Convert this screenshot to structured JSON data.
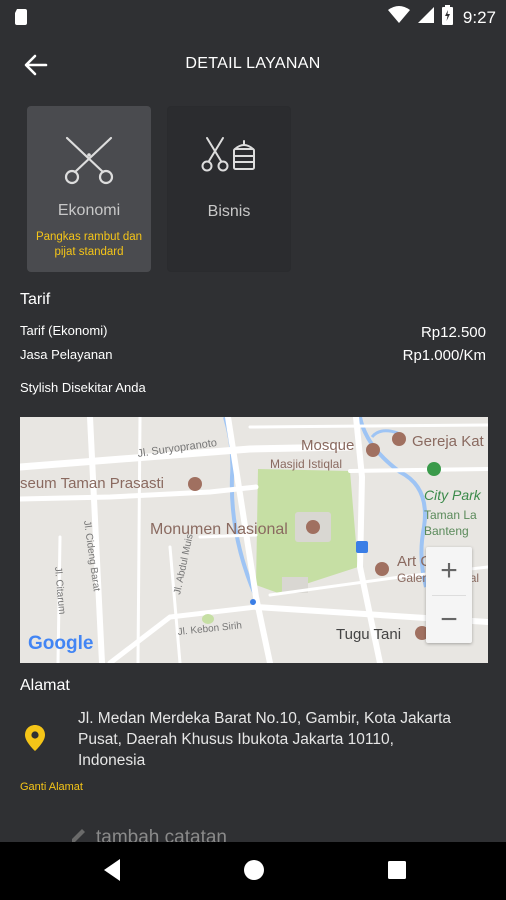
{
  "status_bar": {
    "time": "9:27"
  },
  "app_bar": {
    "title": "DETAIL LAYANAN"
  },
  "services": [
    {
      "name": "Ekonomi",
      "description": "Pangkas rambut dan pijat standard",
      "selected": true,
      "icon": "scissors-icon"
    },
    {
      "name": "Bisnis",
      "description": "",
      "selected": false,
      "icon": "scissors-chair-icon"
    }
  ],
  "tarif": {
    "title": "Tarif",
    "rows": [
      {
        "label": "Tarif (Ekonomi)",
        "value": "Rp12.500"
      },
      {
        "label": "Jasa Pelayanan",
        "value": "Rp1.000/Km"
      }
    ],
    "nearby_label": "Stylish Disekitar Anda"
  },
  "map": {
    "labels": {
      "suryopranoto": "Jl. Suryopranoto",
      "mosque": "Mosque",
      "masjid": "Masjid Istiqlal",
      "gereja": "Gereja Kat",
      "museum": "seum Taman Prasasti",
      "citypark": "City Park",
      "tamanla": "Taman La",
      "banteng": "Banteng",
      "monas": "Monumen Nasional",
      "cideng": "Jl. Cideng Barat",
      "citarum": "Jl. Citarum",
      "abdulmuis": "Jl. Abdul Muis",
      "artgallery": "Art Gallery",
      "galeri": "Galeri Nasional",
      "kebonsirih": "Jl. Kebon Sirih",
      "tugutani": "Tugu Tani",
      "google": "Google"
    },
    "zoom_in": "+",
    "zoom_out": "−"
  },
  "address": {
    "title": "Alamat",
    "text": "Jl. Medan Merdeka Barat No.10, Gambir, Kota Jakarta Pusat, Daerah Khusus Ibukota Jakarta 10110, Indonesia",
    "change_label": "Ganti Alamat",
    "note_placeholder": "tambah catatan"
  },
  "colors": {
    "accent": "#f5c518",
    "background": "#2f3033",
    "card_selected": "#4a4b4f",
    "park": "#c6dfa4"
  }
}
